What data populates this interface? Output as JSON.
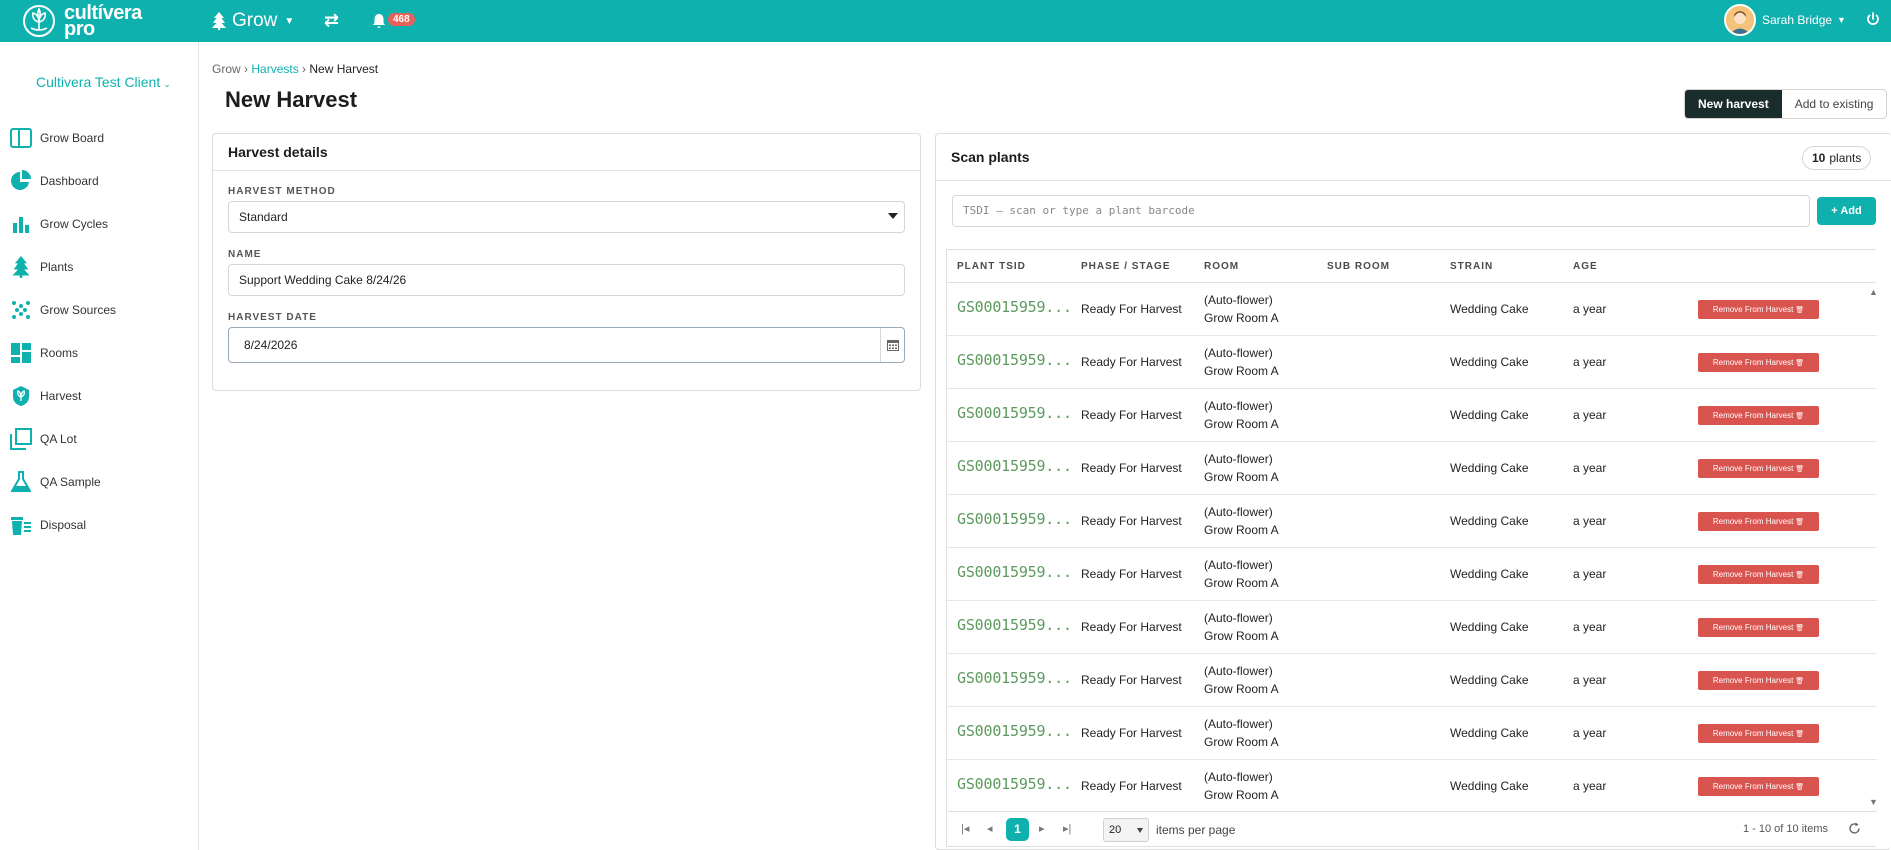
{
  "app": {
    "logo_line1": "cultívera",
    "logo_line2": "pro",
    "module": "Grow",
    "notifications": "468",
    "user_name": "Sarah Bridge"
  },
  "sidebar": {
    "client": "Cultivera Test Client",
    "items": [
      {
        "label": "Grow Board",
        "icon": "grow-board-icon"
      },
      {
        "label": "Dashboard",
        "icon": "pie-chart-icon"
      },
      {
        "label": "Grow Cycles",
        "icon": "bar-chart-icon"
      },
      {
        "label": "Plants",
        "icon": "tree-icon"
      },
      {
        "label": "Grow Sources",
        "icon": "dots-grid-icon"
      },
      {
        "label": "Rooms",
        "icon": "rooms-icon"
      },
      {
        "label": "Harvest",
        "icon": "harvest-icon"
      },
      {
        "label": "QA Lot",
        "icon": "qa-lot-icon"
      },
      {
        "label": "QA Sample",
        "icon": "flask-icon"
      },
      {
        "label": "Disposal",
        "icon": "trash-icon"
      }
    ]
  },
  "breadcrumb": {
    "root": "Grow",
    "sep": "›",
    "link": "Harvests",
    "current": "New Harvest"
  },
  "page": {
    "title": "New Harvest",
    "mode_new": "New harvest",
    "mode_existing": "Add to existing"
  },
  "details": {
    "title": "Harvest details",
    "method_label": "HARVEST METHOD",
    "method_value": "Standard",
    "name_label": "NAME",
    "name_value": "Support Wedding Cake 8/24/26",
    "date_label": "HARVEST DATE",
    "date_value": "8/24/2026"
  },
  "scan": {
    "title": "Scan plants",
    "count": "10",
    "count_unit": "plants",
    "placeholder": "TSDI — scan or type a plant barcode",
    "add_label": "Add",
    "columns": [
      "PLANT TSID",
      "PHASE / STAGE",
      "ROOM",
      "SUB ROOM",
      "STRAIN",
      "AGE"
    ],
    "rows": [
      {
        "tsid": "GS00015959...",
        "phase": "Ready For Harvest",
        "room1": "(Auto-flower)",
        "room2": "Grow Room A",
        "subroom": "",
        "strain": "Wedding Cake",
        "age": "a year",
        "action": "Remove From Harvest"
      },
      {
        "tsid": "GS00015959...",
        "phase": "Ready For Harvest",
        "room1": "(Auto-flower)",
        "room2": "Grow Room A",
        "subroom": "",
        "strain": "Wedding Cake",
        "age": "a year",
        "action": "Remove From Harvest"
      },
      {
        "tsid": "GS00015959...",
        "phase": "Ready For Harvest",
        "room1": "(Auto-flower)",
        "room2": "Grow Room A",
        "subroom": "",
        "strain": "Wedding Cake",
        "age": "a year",
        "action": "Remove From Harvest"
      },
      {
        "tsid": "GS00015959...",
        "phase": "Ready For Harvest",
        "room1": "(Auto-flower)",
        "room2": "Grow Room A",
        "subroom": "",
        "strain": "Wedding Cake",
        "age": "a year",
        "action": "Remove From Harvest"
      },
      {
        "tsid": "GS00015959...",
        "phase": "Ready For Harvest",
        "room1": "(Auto-flower)",
        "room2": "Grow Room A",
        "subroom": "",
        "strain": "Wedding Cake",
        "age": "a year",
        "action": "Remove From Harvest"
      },
      {
        "tsid": "GS00015959...",
        "phase": "Ready For Harvest",
        "room1": "(Auto-flower)",
        "room2": "Grow Room A",
        "subroom": "",
        "strain": "Wedding Cake",
        "age": "a year",
        "action": "Remove From Harvest"
      },
      {
        "tsid": "GS00015959...",
        "phase": "Ready For Harvest",
        "room1": "(Auto-flower)",
        "room2": "Grow Room A",
        "subroom": "",
        "strain": "Wedding Cake",
        "age": "a year",
        "action": "Remove From Harvest"
      },
      {
        "tsid": "GS00015959...",
        "phase": "Ready For Harvest",
        "room1": "(Auto-flower)",
        "room2": "Grow Room A",
        "subroom": "",
        "strain": "Wedding Cake",
        "age": "a year",
        "action": "Remove From Harvest"
      },
      {
        "tsid": "GS00015959...",
        "phase": "Ready For Harvest",
        "room1": "(Auto-flower)",
        "room2": "Grow Room A",
        "subroom": "",
        "strain": "Wedding Cake",
        "age": "a year",
        "action": "Remove From Harvest"
      },
      {
        "tsid": "GS00015959...",
        "phase": "Ready For Harvest",
        "room1": "(Auto-flower)",
        "room2": "Grow Room A",
        "subroom": "",
        "strain": "Wedding Cake",
        "age": "a year",
        "action": "Remove From Harvest"
      }
    ],
    "pager": {
      "current_page": "1",
      "page_size": "20",
      "per_page_label": "items per page",
      "range": "1 - 10 of 10 items"
    }
  },
  "colors": {
    "brand": "#0fb1ae",
    "danger": "#d9534f",
    "tsid": "#5c9a5e",
    "dark_toggle": "#1a2c2c"
  }
}
